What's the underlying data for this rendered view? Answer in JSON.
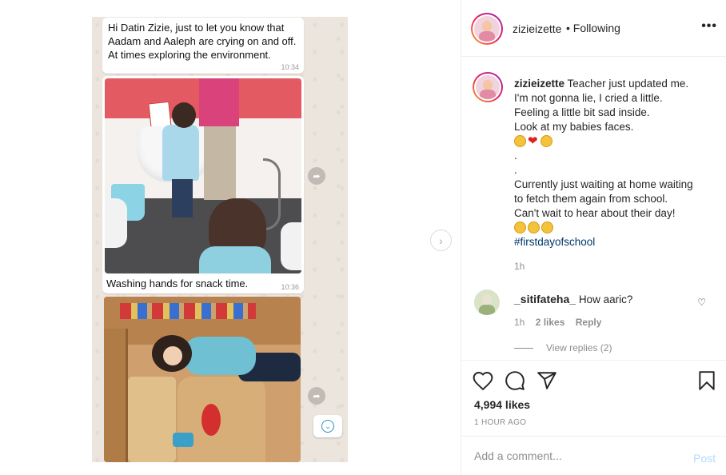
{
  "media": {
    "bubble1_text": "Hi Datin Zizie, just to let you know that Aadam and Aaleph are crying on and off. At times exploring the environment.",
    "bubble1_time": "10:34",
    "bubble2_caption": "Washing hands for snack time.",
    "bubble2_time": "10:36"
  },
  "header": {
    "username": "zizieizette",
    "following_label": "• Following",
    "more_icon": "more-options-icon"
  },
  "caption": {
    "username": "zizieizette",
    "line1": "Teacher just updated me.",
    "line2": "I'm not gonna lie, I cried a little.",
    "line3": "Feeling a little bit sad inside.",
    "line4": "Look at my babies faces.",
    "dot1": ".",
    "dot2": ".",
    "line5": "Currently just waiting at home waiting",
    "line6": "to fetch them again from school.",
    "line7": "Can't wait to hear about their day!",
    "hashtag": "#firstdayofschool",
    "time": "1h"
  },
  "comment": {
    "username": "_sitifateha_",
    "text": "How aaric?",
    "time": "1h",
    "likes": "2 likes",
    "reply_label": "Reply",
    "view_replies": "View replies (2)"
  },
  "actions": {
    "likes": "4,994 likes",
    "timeago": "1 HOUR AGO"
  },
  "add_comment": {
    "placeholder": "Add a comment...",
    "post_label": "Post"
  },
  "colors": {
    "link_blue": "#00376b",
    "post_disabled": "#b3dbff",
    "chat_bg": "#ece5dd",
    "meta_grey": "#8e8e8e"
  }
}
